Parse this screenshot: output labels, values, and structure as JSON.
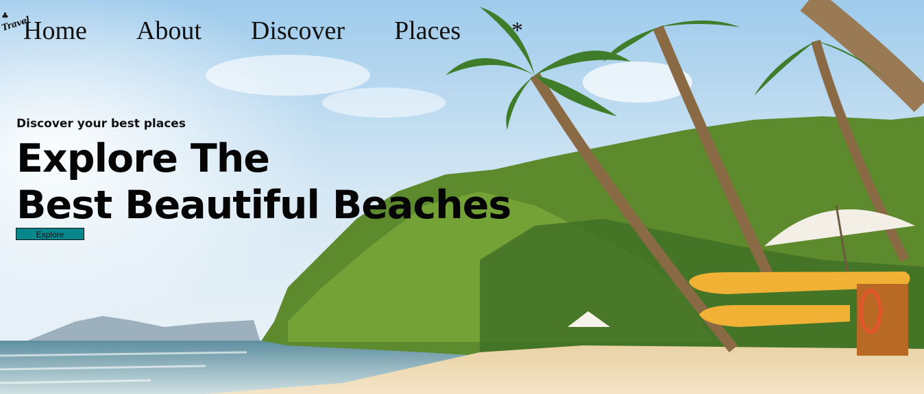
{
  "logo": {
    "text": "Travel",
    "icon": "palm-tree-icon"
  },
  "nav": {
    "items": [
      "Home",
      "About",
      "Discover",
      "Places"
    ],
    "extra_icon": "*"
  },
  "hero": {
    "kicker": "Discover your best places",
    "headline_line1": "Explore The",
    "headline_line2": "Best Beautiful Beaches",
    "cta_label": "Explore"
  },
  "colors": {
    "cta_background": "#08868c",
    "text": "#111111",
    "sky": "#a9d3ee",
    "sand": "#efdcb6"
  }
}
